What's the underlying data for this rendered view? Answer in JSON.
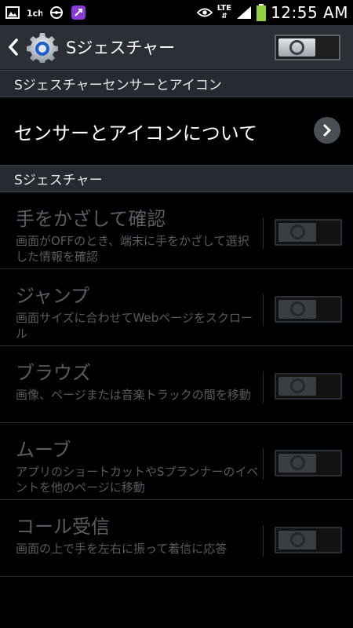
{
  "status_bar": {
    "time": "12:55 AM",
    "network": "LTE",
    "icons": [
      "image-icon",
      "tv-icon",
      "steering-icon",
      "app-icon",
      "eye-icon",
      "lte-icon",
      "signal-icon",
      "battery-icon"
    ]
  },
  "action_bar": {
    "title": "Sジェスチャー",
    "master_switch_on": false
  },
  "sections": {
    "sensor_header": "Sジェスチャーセンサーとアイコン",
    "sensor_item": "センサーとアイコンについて",
    "gesture_header": "Sジェスチャー"
  },
  "gestures": [
    {
      "title": "手をかざして確認",
      "desc": "画面がOFFのとき、端末に手をかざして選択した情報を確認",
      "enabled": false
    },
    {
      "title": "ジャンプ",
      "desc": "画面サイズに合わせてWebページをスクロール",
      "enabled": false
    },
    {
      "title": "ブラウズ",
      "desc": "画像、ページまたは音楽トラックの間を移動",
      "enabled": false
    },
    {
      "title": "ムーブ",
      "desc": "アプリのショートカットやSプランナーのイベントを他のページに移動",
      "enabled": false
    },
    {
      "title": "コール受信",
      "desc": "画面の上で手を左右に振って着信に応答",
      "enabled": false
    }
  ],
  "colors": {
    "action_bar": "#2c3036",
    "section_header": "#252b31",
    "disabled_text": "#5a5d62"
  }
}
